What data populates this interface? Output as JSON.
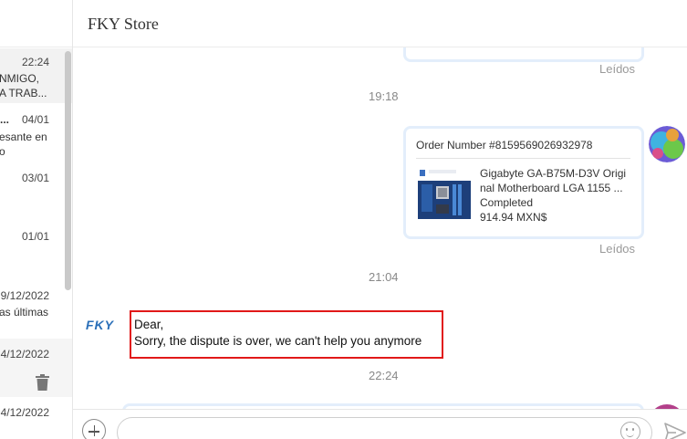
{
  "header": {
    "title": "FKY Store"
  },
  "sidebar": {
    "conversations": [
      {
        "time": "22:24",
        "lines": [
          "NMIGO,",
          "A TRAB..."
        ]
      },
      {
        "time": "04/01",
        "prefix": "...",
        "lines": [
          "esante en",
          "o"
        ]
      },
      {
        "time": "03/01",
        "lines": []
      },
      {
        "time": "01/01",
        "lines": []
      },
      {
        "time": "9/12/2022",
        "lines": [
          "as últimas"
        ]
      },
      {
        "time": "4/12/2022",
        "lines": []
      },
      {
        "time": "4/12/2022",
        "lines": []
      }
    ]
  },
  "chat": {
    "read_label_1": "Leídos",
    "timestamp_1": "19:18",
    "order": {
      "number": "Order Number #8159569026932978",
      "product_line1": "Gigabyte GA-B75M-D3V Origi",
      "product_line2": "nal Motherboard LGA 1155 ...",
      "status": "Completed",
      "price": "914.94 MXN$"
    },
    "read_label_2": "Leídos",
    "timestamp_2": "21:04",
    "store_logo": "FKY",
    "message": {
      "line1": "Dear,",
      "line2": "Sorry, the dispute is over, we can't help you anymore"
    },
    "timestamp_3": "22:24"
  },
  "input": {
    "placeholder": ""
  },
  "colors": {
    "accent": "#2a6fb8",
    "highlight_border": "#e11919",
    "card_border": "#e3eefb"
  }
}
